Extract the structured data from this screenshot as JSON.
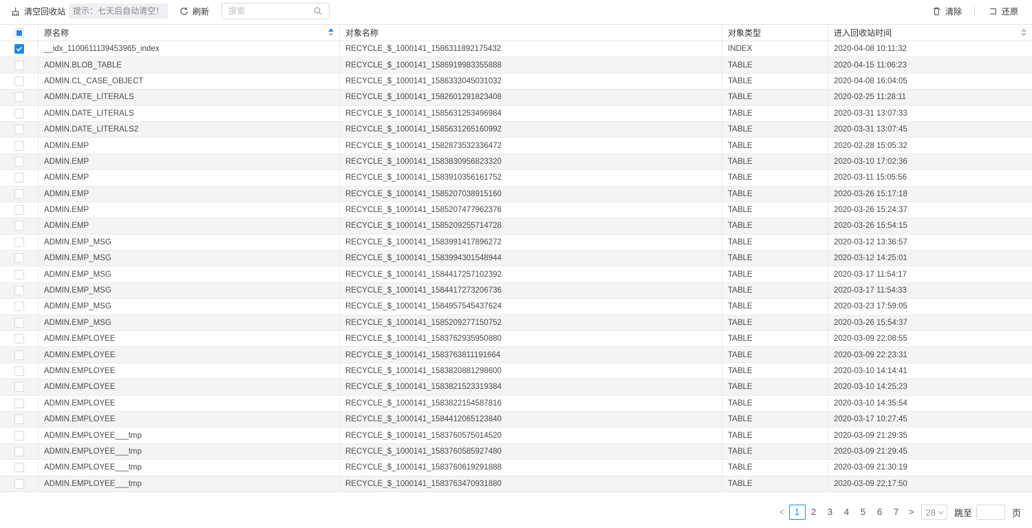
{
  "toolbar": {
    "empty_label": "清空回收站",
    "tip": "提示：七天后自动清空！",
    "refresh_label": "刷新",
    "search_placeholder": "搜索",
    "clear_label": "清除",
    "restore_label": "还原"
  },
  "colors": {
    "accent": "#1e88e5",
    "stripe": "#f3f4f6"
  },
  "table": {
    "columns": [
      "原名称",
      "对象名称",
      "对象类型",
      "进入回收站时间"
    ],
    "rows": [
      {
        "checked": true,
        "original": "__idx_1100611139453965_index",
        "object": "RECYCLE_$_1000141_1586311892175432",
        "type": "INDEX",
        "time": "2020-04-08 10:11:32"
      },
      {
        "checked": false,
        "original": "ADMIN.BLOB_TABLE",
        "object": "RECYCLE_$_1000141_1586919983355888",
        "type": "TABLE",
        "time": "2020-04-15 11:06:23"
      },
      {
        "checked": false,
        "original": "ADMIN.CL_CASE_OBJECT",
        "object": "RECYCLE_$_1000141_1586333045031032",
        "type": "TABLE",
        "time": "2020-04-08 16:04:05"
      },
      {
        "checked": false,
        "original": "ADMIN.DATE_LITERALS",
        "object": "RECYCLE_$_1000141_1582601291823408",
        "type": "TABLE",
        "time": "2020-02-25 11:28:11"
      },
      {
        "checked": false,
        "original": "ADMIN.DATE_LITERALS",
        "object": "RECYCLE_$_1000141_1585631253496984",
        "type": "TABLE",
        "time": "2020-03-31 13:07:33"
      },
      {
        "checked": false,
        "original": "ADMIN.DATE_LITERALS2",
        "object": "RECYCLE_$_1000141_1585631265160992",
        "type": "TABLE",
        "time": "2020-03-31 13:07:45"
      },
      {
        "checked": false,
        "original": "ADMIN.EMP",
        "object": "RECYCLE_$_1000141_1582873532336472",
        "type": "TABLE",
        "time": "2020-02-28 15:05:32"
      },
      {
        "checked": false,
        "original": "ADMIN.EMP",
        "object": "RECYCLE_$_1000141_1583830956823320",
        "type": "TABLE",
        "time": "2020-03-10 17:02:36"
      },
      {
        "checked": false,
        "original": "ADMIN.EMP",
        "object": "RECYCLE_$_1000141_1583910356161752",
        "type": "TABLE",
        "time": "2020-03-11 15:05:56"
      },
      {
        "checked": false,
        "original": "ADMIN.EMP",
        "object": "RECYCLE_$_1000141_1585207038915160",
        "type": "TABLE",
        "time": "2020-03-26 15:17:18"
      },
      {
        "checked": false,
        "original": "ADMIN.EMP",
        "object": "RECYCLE_$_1000141_1585207477962376",
        "type": "TABLE",
        "time": "2020-03-26 15:24:37"
      },
      {
        "checked": false,
        "original": "ADMIN.EMP",
        "object": "RECYCLE_$_1000141_1585209255714728",
        "type": "TABLE",
        "time": "2020-03-26 15:54:15"
      },
      {
        "checked": false,
        "original": "ADMIN.EMP_MSG",
        "object": "RECYCLE_$_1000141_1583991417896272",
        "type": "TABLE",
        "time": "2020-03-12 13:36:57"
      },
      {
        "checked": false,
        "original": "ADMIN.EMP_MSG",
        "object": "RECYCLE_$_1000141_1583994301548944",
        "type": "TABLE",
        "time": "2020-03-12 14:25:01"
      },
      {
        "checked": false,
        "original": "ADMIN.EMP_MSG",
        "object": "RECYCLE_$_1000141_1584417257102392",
        "type": "TABLE",
        "time": "2020-03-17 11:54:17"
      },
      {
        "checked": false,
        "original": "ADMIN.EMP_MSG",
        "object": "RECYCLE_$_1000141_1584417273206736",
        "type": "TABLE",
        "time": "2020-03-17 11:54:33"
      },
      {
        "checked": false,
        "original": "ADMIN.EMP_MSG",
        "object": "RECYCLE_$_1000141_1584957545437624",
        "type": "TABLE",
        "time": "2020-03-23 17:59:05"
      },
      {
        "checked": false,
        "original": "ADMIN.EMP_MSG",
        "object": "RECYCLE_$_1000141_1585209277150752",
        "type": "TABLE",
        "time": "2020-03-26 15:54:37"
      },
      {
        "checked": false,
        "original": "ADMIN.EMPLOYEE",
        "object": "RECYCLE_$_1000141_1583762935950880",
        "type": "TABLE",
        "time": "2020-03-09 22:08:55"
      },
      {
        "checked": false,
        "original": "ADMIN.EMPLOYEE",
        "object": "RECYCLE_$_1000141_1583763811191664",
        "type": "TABLE",
        "time": "2020-03-09 22:23:31"
      },
      {
        "checked": false,
        "original": "ADMIN.EMPLOYEE",
        "object": "RECYCLE_$_1000141_1583820881298600",
        "type": "TABLE",
        "time": "2020-03-10 14:14:41"
      },
      {
        "checked": false,
        "original": "ADMIN.EMPLOYEE",
        "object": "RECYCLE_$_1000141_1583821523319384",
        "type": "TABLE",
        "time": "2020-03-10 14:25:23"
      },
      {
        "checked": false,
        "original": "ADMIN.EMPLOYEE",
        "object": "RECYCLE_$_1000141_1583822154587816",
        "type": "TABLE",
        "time": "2020-03-10 14:35:54"
      },
      {
        "checked": false,
        "original": "ADMIN.EMPLOYEE",
        "object": "RECYCLE_$_1000141_1584412065123840",
        "type": "TABLE",
        "time": "2020-03-17 10:27:45"
      },
      {
        "checked": false,
        "original": "ADMIN.EMPLOYEE___tmp",
        "object": "RECYCLE_$_1000141_1583760575014520",
        "type": "TABLE",
        "time": "2020-03-09 21:29:35"
      },
      {
        "checked": false,
        "original": "ADMIN.EMPLOYEE___tmp",
        "object": "RECYCLE_$_1000141_1583760585927480",
        "type": "TABLE",
        "time": "2020-03-09 21:29:45"
      },
      {
        "checked": false,
        "original": "ADMIN.EMPLOYEE___tmp",
        "object": "RECYCLE_$_1000141_1583760619291888",
        "type": "TABLE",
        "time": "2020-03-09 21:30:19"
      },
      {
        "checked": false,
        "original": "ADMIN.EMPLOYEE___tmp",
        "object": "RECYCLE_$_1000141_1583763470931880",
        "type": "TABLE",
        "time": "2020-03-09 22:17:50"
      }
    ]
  },
  "pagination": {
    "prev": "<",
    "next": ">",
    "pages": [
      "1",
      "2",
      "3",
      "4",
      "5",
      "6",
      "7"
    ],
    "current": "1",
    "page_size": "28",
    "jump_label": "跳至",
    "jump_value": "",
    "page_suffix": "页"
  }
}
